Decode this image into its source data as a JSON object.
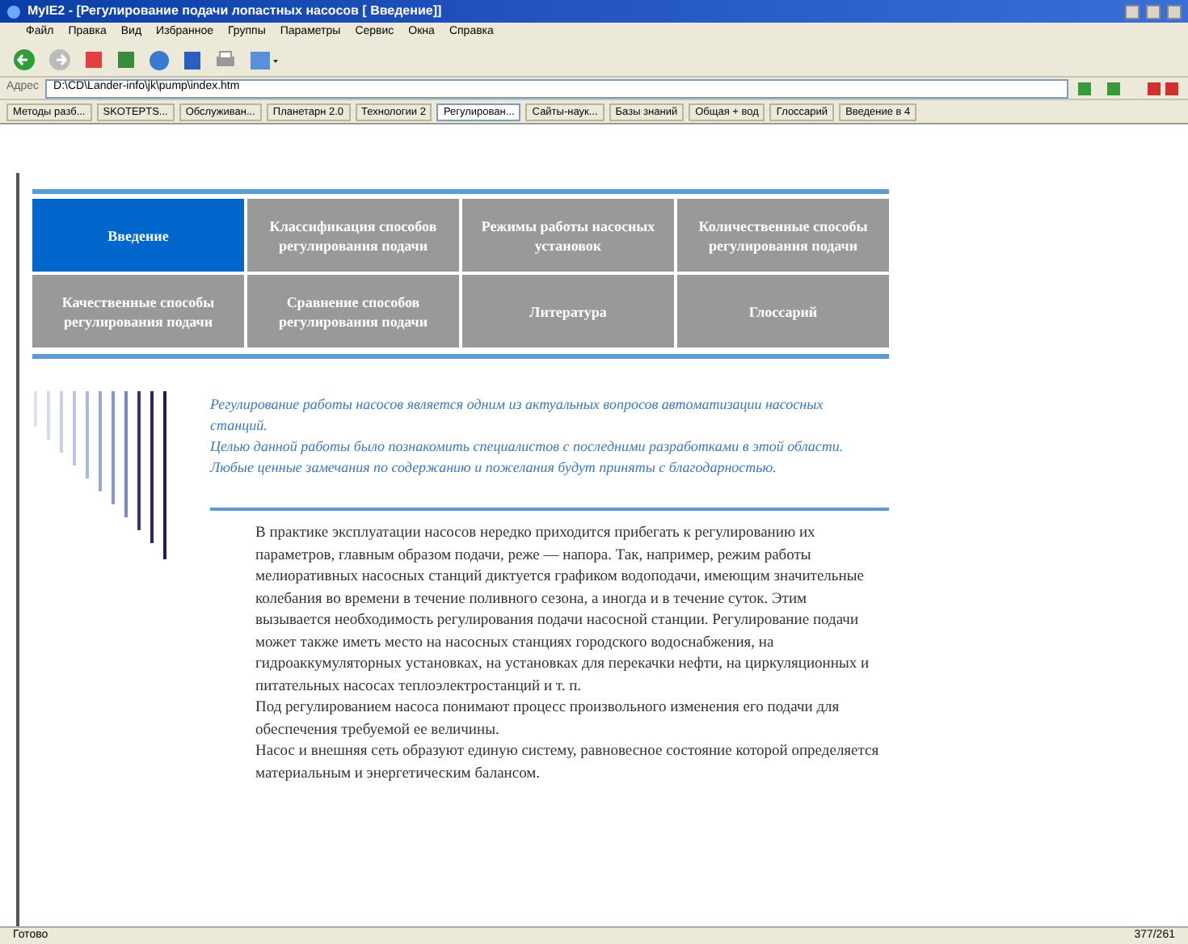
{
  "window": {
    "title": "MyIE2 - [Регулирование подачи лопастных насосов [ Введение]]"
  },
  "menu": [
    "Файл",
    "Правка",
    "Вид",
    "Избранное",
    "Группы",
    "Параметры",
    "Сервис",
    "Окна",
    "Справка"
  ],
  "address_bar": {
    "label": "Адрес",
    "value": "D:\\CD\\Lander-info\\jk\\pump\\index.htm"
  },
  "browser_tabs": [
    {
      "label": "Методы разб...",
      "selected": false
    },
    {
      "label": "SKOTEPTS...",
      "selected": false
    },
    {
      "label": "Обслуживан...",
      "selected": false
    },
    {
      "label": "Планетарн 2.0",
      "selected": false
    },
    {
      "label": "Технологии 2",
      "selected": false
    },
    {
      "label": "Регулирован...",
      "selected": true
    },
    {
      "label": "Сайты-наук...",
      "selected": false
    },
    {
      "label": "Базы знаний",
      "selected": false
    },
    {
      "label": "Общая + вод",
      "selected": false
    },
    {
      "label": "Глоссарий",
      "selected": false
    },
    {
      "label": "Введение в 4",
      "selected": false
    }
  ],
  "nav": [
    {
      "label": "Введение",
      "selected": true
    },
    {
      "label": "Классификация способов регулирования подачи",
      "selected": false
    },
    {
      "label": "Режимы работы насосных установок",
      "selected": false
    },
    {
      "label": "Количественные способы регулирования подачи",
      "selected": false
    },
    {
      "label": "Качественные способы регулирования подачи",
      "selected": false
    },
    {
      "label": "Сравнение способов регулирования подачи",
      "selected": false
    },
    {
      "label": "Литература",
      "selected": false
    },
    {
      "label": "Глоссарий",
      "selected": false
    }
  ],
  "intro": [
    "Регулирование работы насосов является одним из актуальных вопросов автоматизации насосных станций.",
    "Целью данной работы было познакомить специалистов с последними разработками в этой области.",
    "Любые ценные замечания по содержанию и пожелания будут приняты с благодарностью."
  ],
  "body": [
    "В практике эксплуатации насосов нередко приходится прибегать к регулированию их параметров, главным образом подачи, реже — напора. Так, например, режим работы мелиоративных насосных станций диктуется графиком водоподачи, имеющим значительные колебания во времени в течение поливного сезона, а иногда и в течение суток. Этим вызывается необходимость регулирования подачи насосной станции. Регулирование подачи может также иметь место на насосных станциях городского водоснабжения, на гидроаккумуляторных установках, на установках для перекачки нефти, на циркуляционных и питательных насосах теплоэлектростанций и т. п.",
    "Под регулированием насоса понимают процесс произвольного изменения его подачи для обеспечения требуемой ее величины.",
    "Насос и внешняя сеть образуют единую систему, равновесное состояние которой определяется материальным и энергетическим балансом."
  ],
  "status_bar": {
    "left": "Готово",
    "right": "377/261"
  }
}
